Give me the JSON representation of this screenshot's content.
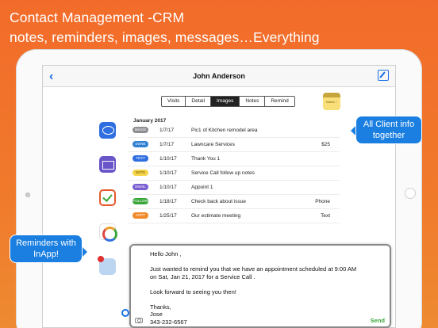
{
  "headline": {
    "line1": "Contact Management -CRM",
    "line2": "notes, reminders, images, messages…Everything"
  },
  "nav": {
    "title": "John Anderson"
  },
  "tabs": [
    {
      "label": "Visits",
      "active": false
    },
    {
      "label": "Detail",
      "active": false
    },
    {
      "label": "Images",
      "active": true
    },
    {
      "label": "Notes",
      "active": false
    },
    {
      "label": "Remind",
      "active": false
    }
  ],
  "notes_thumb_label": "Notes +",
  "month": "January 2017",
  "rows": [
    {
      "tag": "IMAGE",
      "tag_color": "#8e8e93",
      "date": "1/7/17",
      "desc": "Pic1 of Kitchen remodel area",
      "amount": ""
    },
    {
      "tag": "DONE",
      "tag_color": "#2f7fd3",
      "date": "1/7/17",
      "desc": "Lawncare Services",
      "amount": "$25"
    },
    {
      "tag": "TEXT",
      "tag_color": "#2f6fe0",
      "date": "1/10/17",
      "desc": "Thank You 1",
      "amount": ""
    },
    {
      "tag": "NOTE",
      "tag_color": "#f5d54a",
      "date": "1/10/17",
      "desc": "Service Call follow up notes",
      "amount": ""
    },
    {
      "tag": "EMAIL",
      "tag_color": "#7a5fd0",
      "date": "1/10/17",
      "desc": "Appoint 1",
      "amount": ""
    },
    {
      "tag": "FOLLOW",
      "tag_color": "#3aa63a",
      "date": "1/18/17",
      "desc": "Check back about issue",
      "amount": "Phone"
    },
    {
      "tag": "APPT",
      "tag_color": "#f08a2a",
      "date": "1/25/17",
      "desc": "Our estimate meeting",
      "amount": "Text"
    }
  ],
  "callouts": {
    "client_info": "All Client info together",
    "reminders": "Reminders with InApp!"
  },
  "message": {
    "lines": [
      "Hello John ,",
      "",
      "Just wanted to remind you that we have an appointment scheduled at 9:00 AM",
      "on Sat, Jan 21, 2017 for a Service Call .",
      "",
      "Look forward to seeing you then!",
      "",
      "Thanks,",
      "Jose",
      "343-232-6567"
    ],
    "send_label": "Send"
  }
}
